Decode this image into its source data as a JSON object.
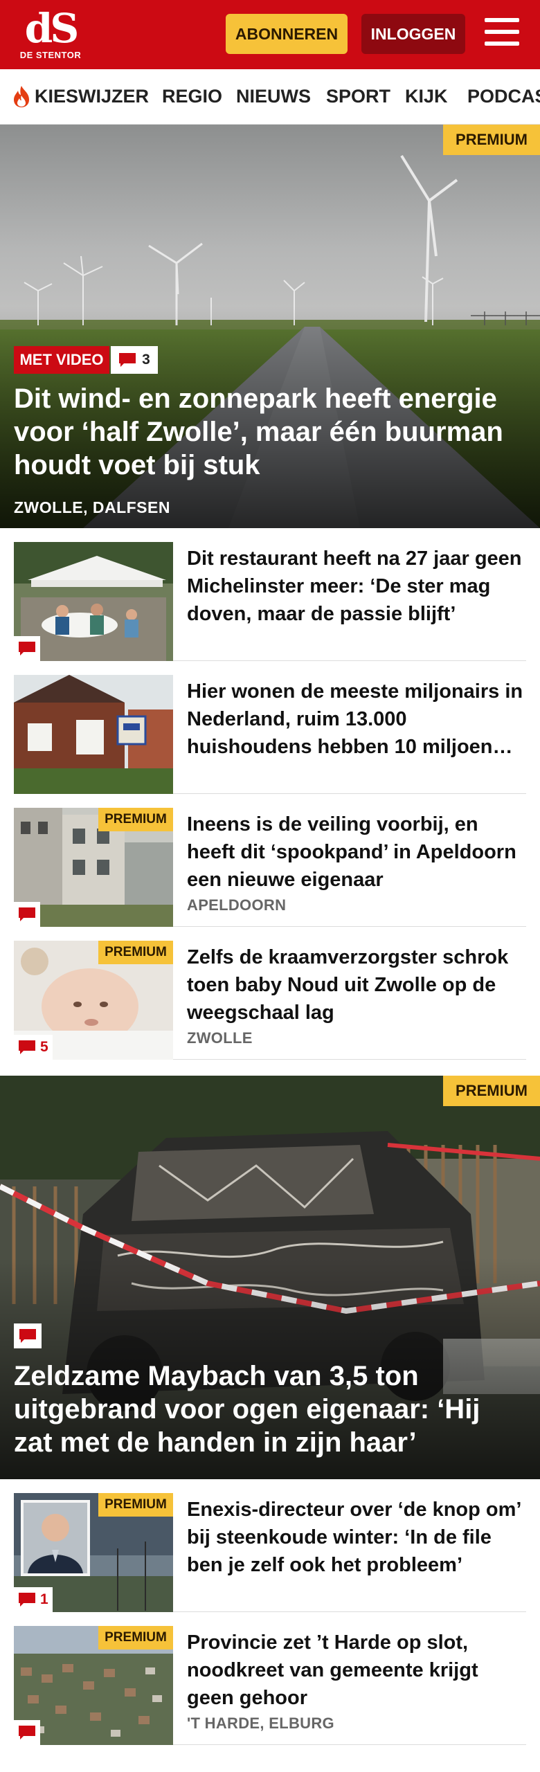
{
  "header": {
    "logo_text": "dS",
    "logo_sub": "DE STENTOR",
    "subscribe_label": "ABONNEREN",
    "login_label": "INLOGGEN"
  },
  "nav": {
    "items": [
      "KIESWIJZER",
      "REGIO",
      "NIEUWS",
      "SPORT",
      "KIJK",
      "PODCAS"
    ]
  },
  "hero1": {
    "premium": "PREMIUM",
    "video_tag": "MET VIDEO",
    "comment_count": "3",
    "title": "Dit wind- en zonnepark heeft energie voor ‘half Zwolle’, maar één buurman houdt voet bij stuk",
    "location": "ZWOLLE, DALFSEN"
  },
  "articles": [
    {
      "title": "Dit restaurant heeft na 27 jaar geen Michelinster meer: ‘De ster mag doven, maar de passie blijft’",
      "location": "",
      "premium": "",
      "comments": ""
    },
    {
      "title": "Hier wonen de meeste miljonairs in Nederland, ruim 13.000 huishoudens hebben 10 miljoen…",
      "location": "",
      "premium": "",
      "comments": ""
    },
    {
      "title": "Ineens is de veiling voorbij, en heeft dit ‘spookpand’ in Apeldoorn een nieuwe eigenaar",
      "location": "APELDOORN",
      "premium": "PREMIUM",
      "comments": ""
    },
    {
      "title": "Zelfs de kraamverzorgster schrok toen baby Noud uit Zwolle op de weegschaal lag",
      "location": "ZWOLLE",
      "premium": "PREMIUM",
      "comments": "5"
    }
  ],
  "hero2": {
    "premium": "PREMIUM",
    "title": "Zeldzame Maybach van 3,5 ton uitgebrand voor ogen eigenaar: ‘Hij zat met de handen in zijn haar’"
  },
  "articles2": [
    {
      "title": "Enexis-directeur over ‘de knop om’ bij steenkoude winter: ‘In de file ben je zelf ook het probleem’",
      "location": "",
      "premium": "PREMIUM",
      "comments": "1"
    },
    {
      "title": "Provincie zet ’t Harde op slot, noodkreet van gemeente krijgt geen gehoor",
      "location": "'T HARDE, ELBURG",
      "premium": "PREMIUM",
      "comments": ""
    }
  ],
  "colors": {
    "brand_red": "#cc0a13",
    "premium_yellow": "#f6c239",
    "login_dark_red": "#8e0910"
  }
}
